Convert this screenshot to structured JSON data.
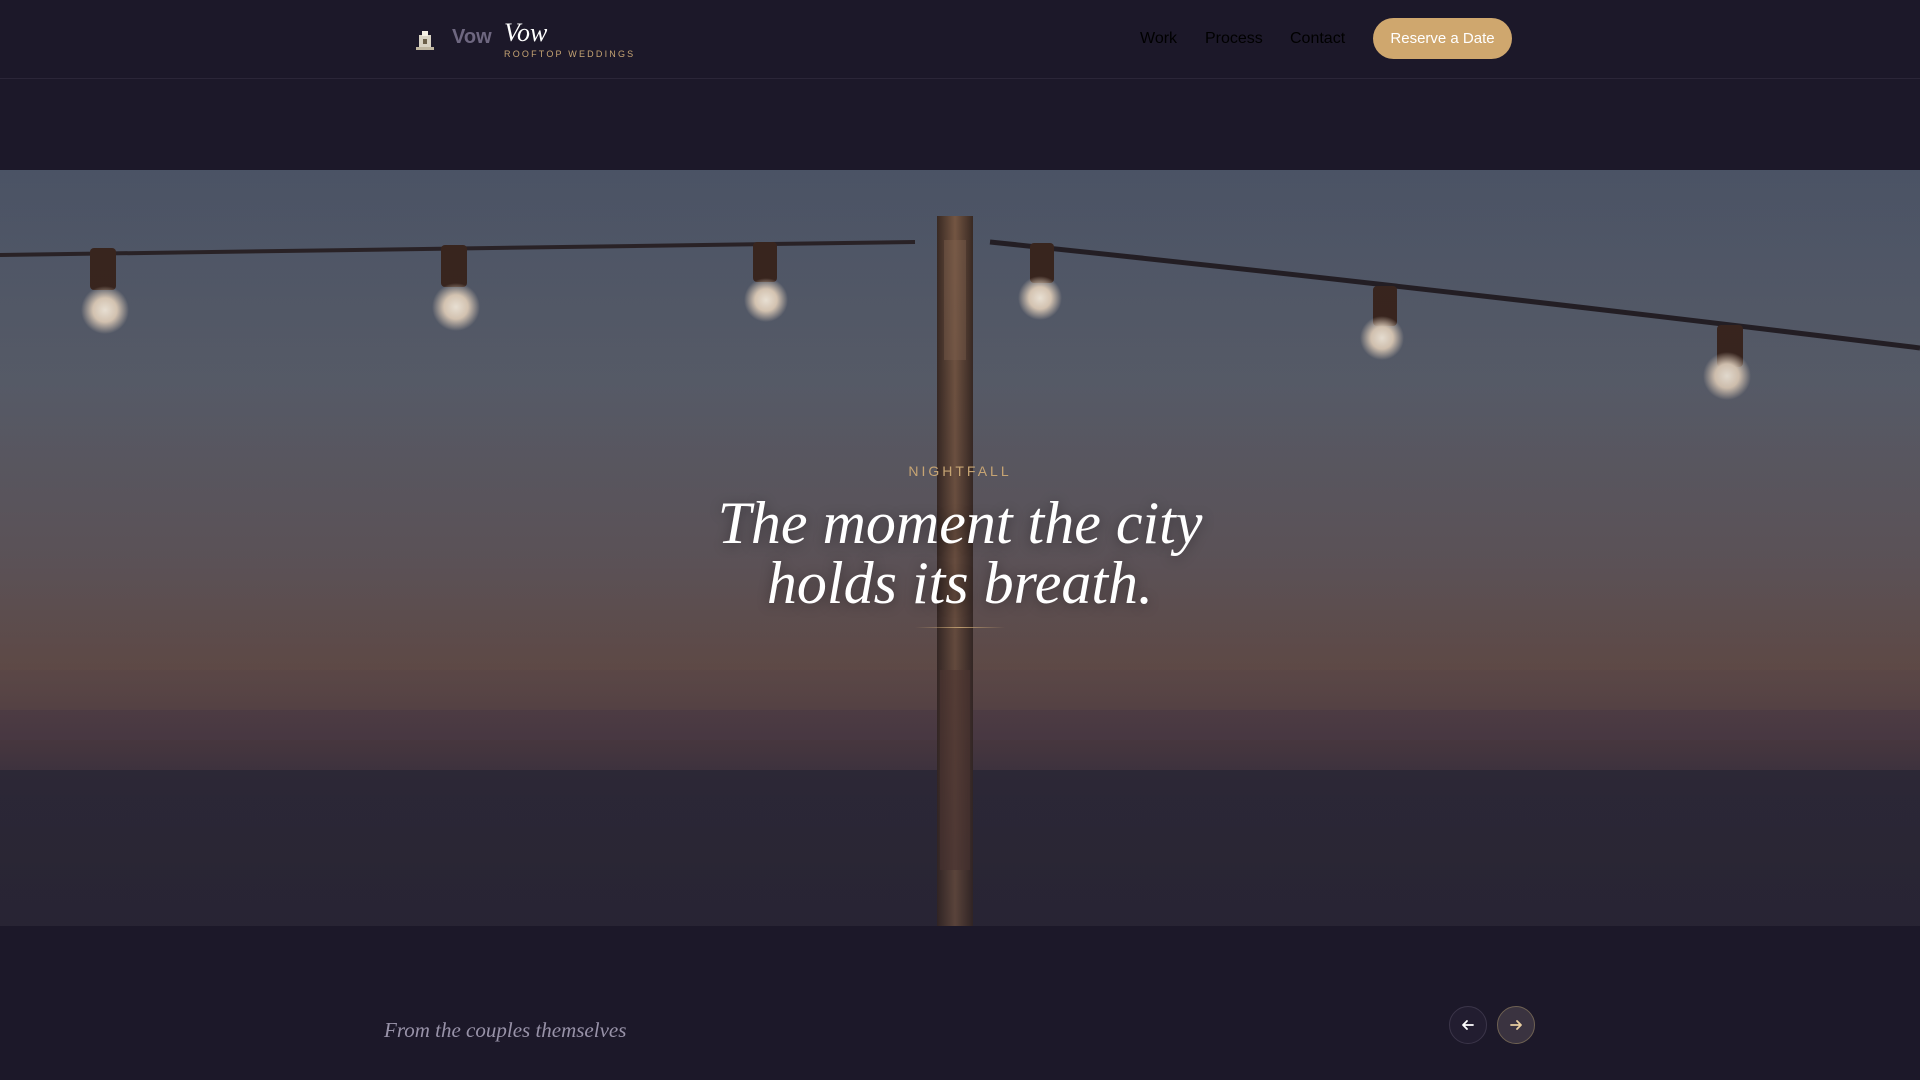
{
  "header": {
    "logo_alt_text": "Vow",
    "brand_name": "Vow",
    "brand_tagline": "ROOFTOP WEDDINGS",
    "nav": [
      {
        "label": "Work"
      },
      {
        "label": "Process"
      },
      {
        "label": "Contact"
      }
    ],
    "cta_label": "Reserve a Date"
  },
  "hero": {
    "eyebrow": "NIGHTFALL",
    "headline_line1": "The moment the city",
    "headline_line2": "holds its breath."
  },
  "testimonials": {
    "title": "From the couples themselves",
    "prev_icon": "arrow-left-icon",
    "next_icon": "arrow-right-icon"
  },
  "colors": {
    "background": "#1c1829",
    "accent": "#cfa76e",
    "eyebrow": "#c6a473"
  }
}
